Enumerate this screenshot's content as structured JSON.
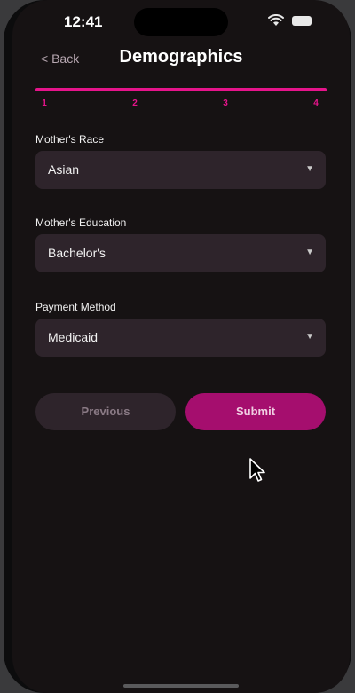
{
  "status_bar": {
    "time": "12:41",
    "wifi_icon": "wifi-icon",
    "battery_icon": "battery-icon"
  },
  "nav": {
    "back_label": "< Back",
    "title": "Demographics"
  },
  "progress": {
    "fraction": 1.0,
    "steps": [
      "1",
      "2",
      "3",
      "4"
    ],
    "color": "#e6148b"
  },
  "fields": [
    {
      "label": "Mother's Race",
      "value": "Asian"
    },
    {
      "label": "Mother's Education",
      "value": "Bachelor's"
    },
    {
      "label": "Payment Method",
      "value": "Medicaid"
    }
  ],
  "chevron_glyph": "▼",
  "buttons": {
    "previous": "Previous",
    "submit": "Submit"
  },
  "colors": {
    "accent": "#e6148b",
    "submit_bg": "#a50e6e",
    "field_bg": "#2e242b",
    "screen_bg": "#161213"
  }
}
